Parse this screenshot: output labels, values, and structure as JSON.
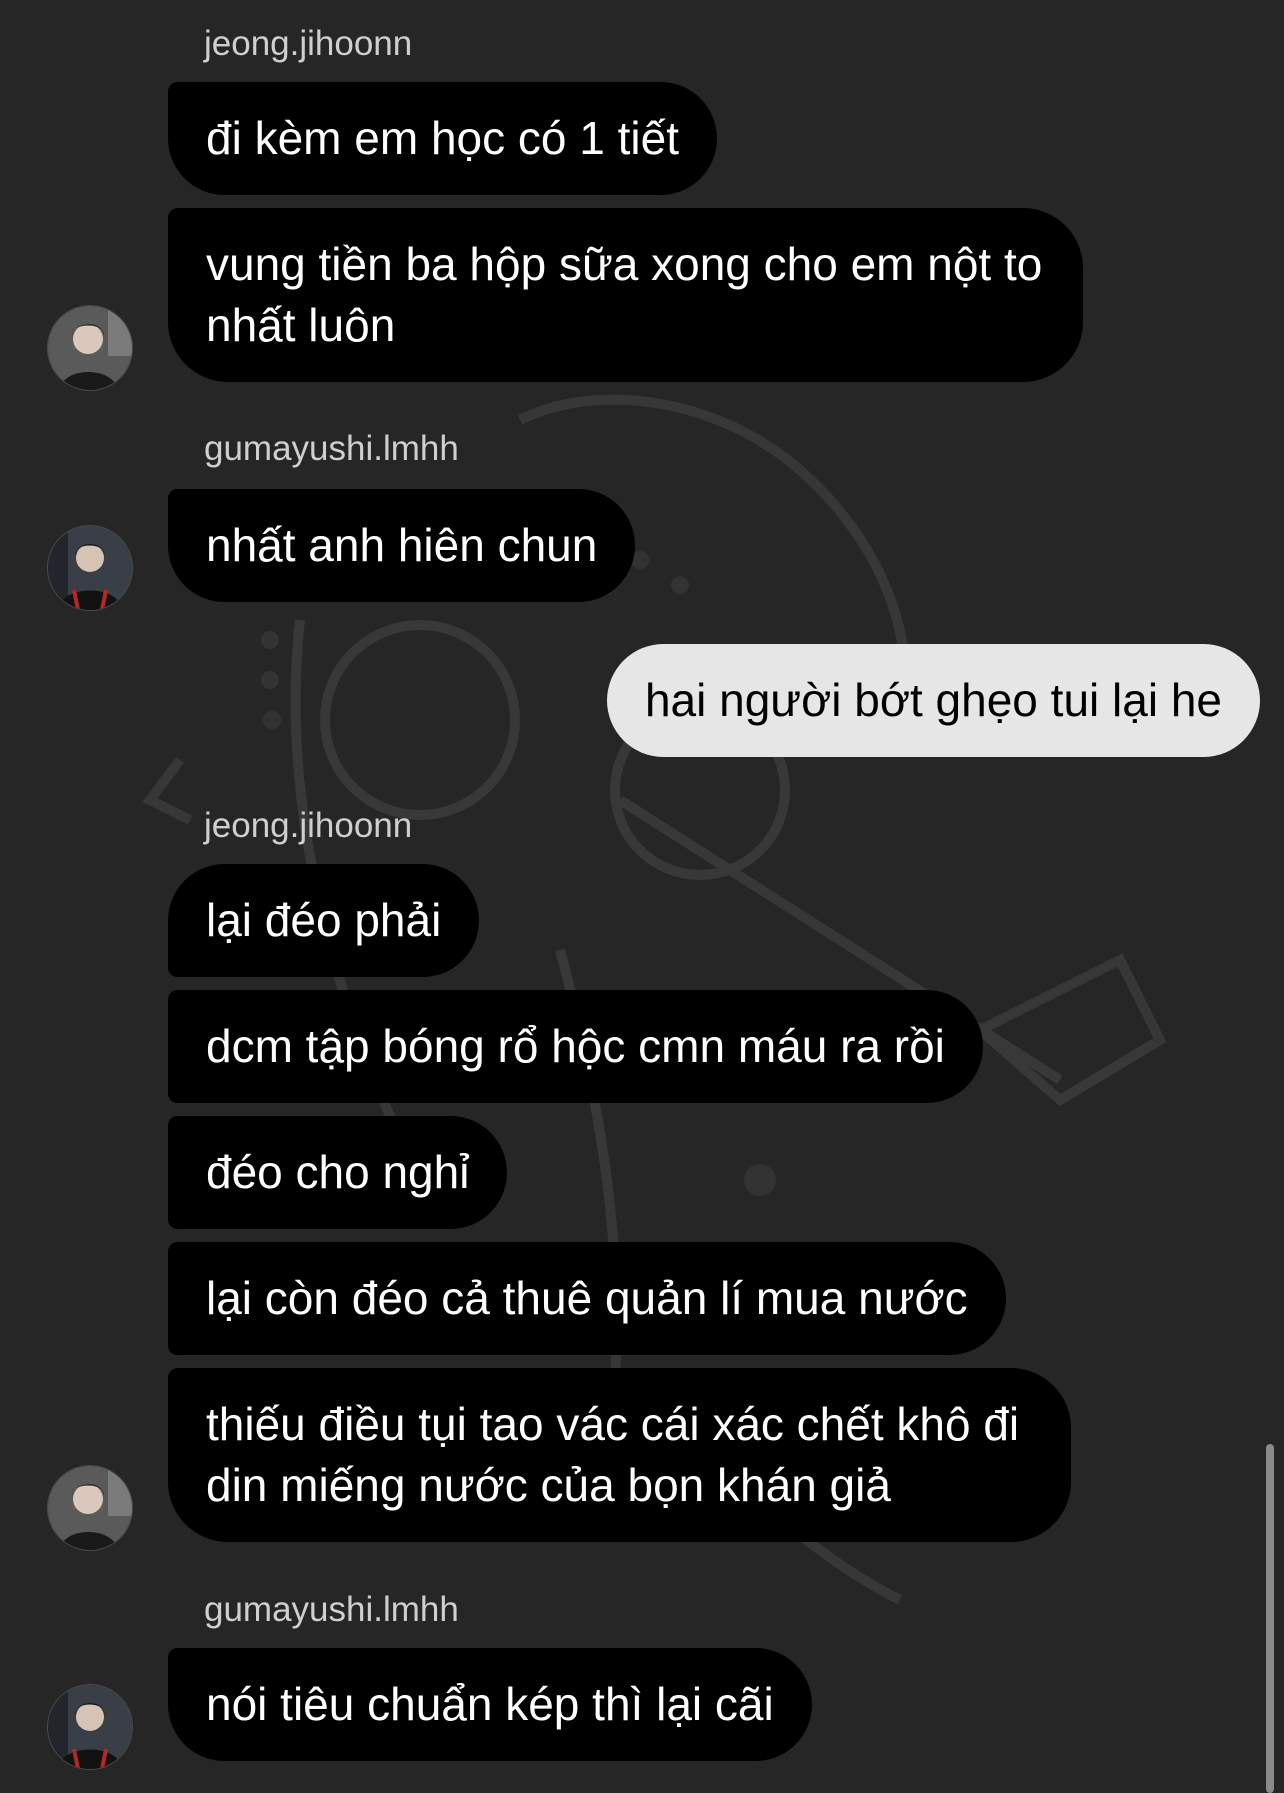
{
  "thread": {
    "messages": [
      {
        "sender": "jeong.jihoonn",
        "text": "đi kèm em học có 1 tiết"
      },
      {
        "text": "vung tiền ba hộp sữa xong cho em nột to nhất luôn"
      },
      {
        "sender": "gumayushi.lmhh",
        "text": "nhất anh hiên chun"
      },
      {
        "text": "hai người bớt ghẹo tui lại he",
        "outgoing": true
      },
      {
        "sender": "jeong.jihoonn",
        "text": "lại đéo phải"
      },
      {
        "text": "dcm tập bóng rổ hộc cmn máu ra rồi"
      },
      {
        "text": "đéo cho nghỉ"
      },
      {
        "text": "lại còn đéo cả thuê quản lí mua nước"
      },
      {
        "text": "thiếu điều tụi tao vác cái xác chết khô đi din miếng nước của bọn khán giả"
      },
      {
        "sender": "gumayushi.lmhh",
        "text": "nói tiêu chuẩn kép thì lại cãi"
      }
    ]
  },
  "colors": {
    "background": "#262626",
    "incoming_bubble": "#000000",
    "outgoing_bubble": "#e6e6e6"
  },
  "icons": [
    "avatar-jeong-jihoonn",
    "avatar-gumayushi-lmhh"
  ]
}
